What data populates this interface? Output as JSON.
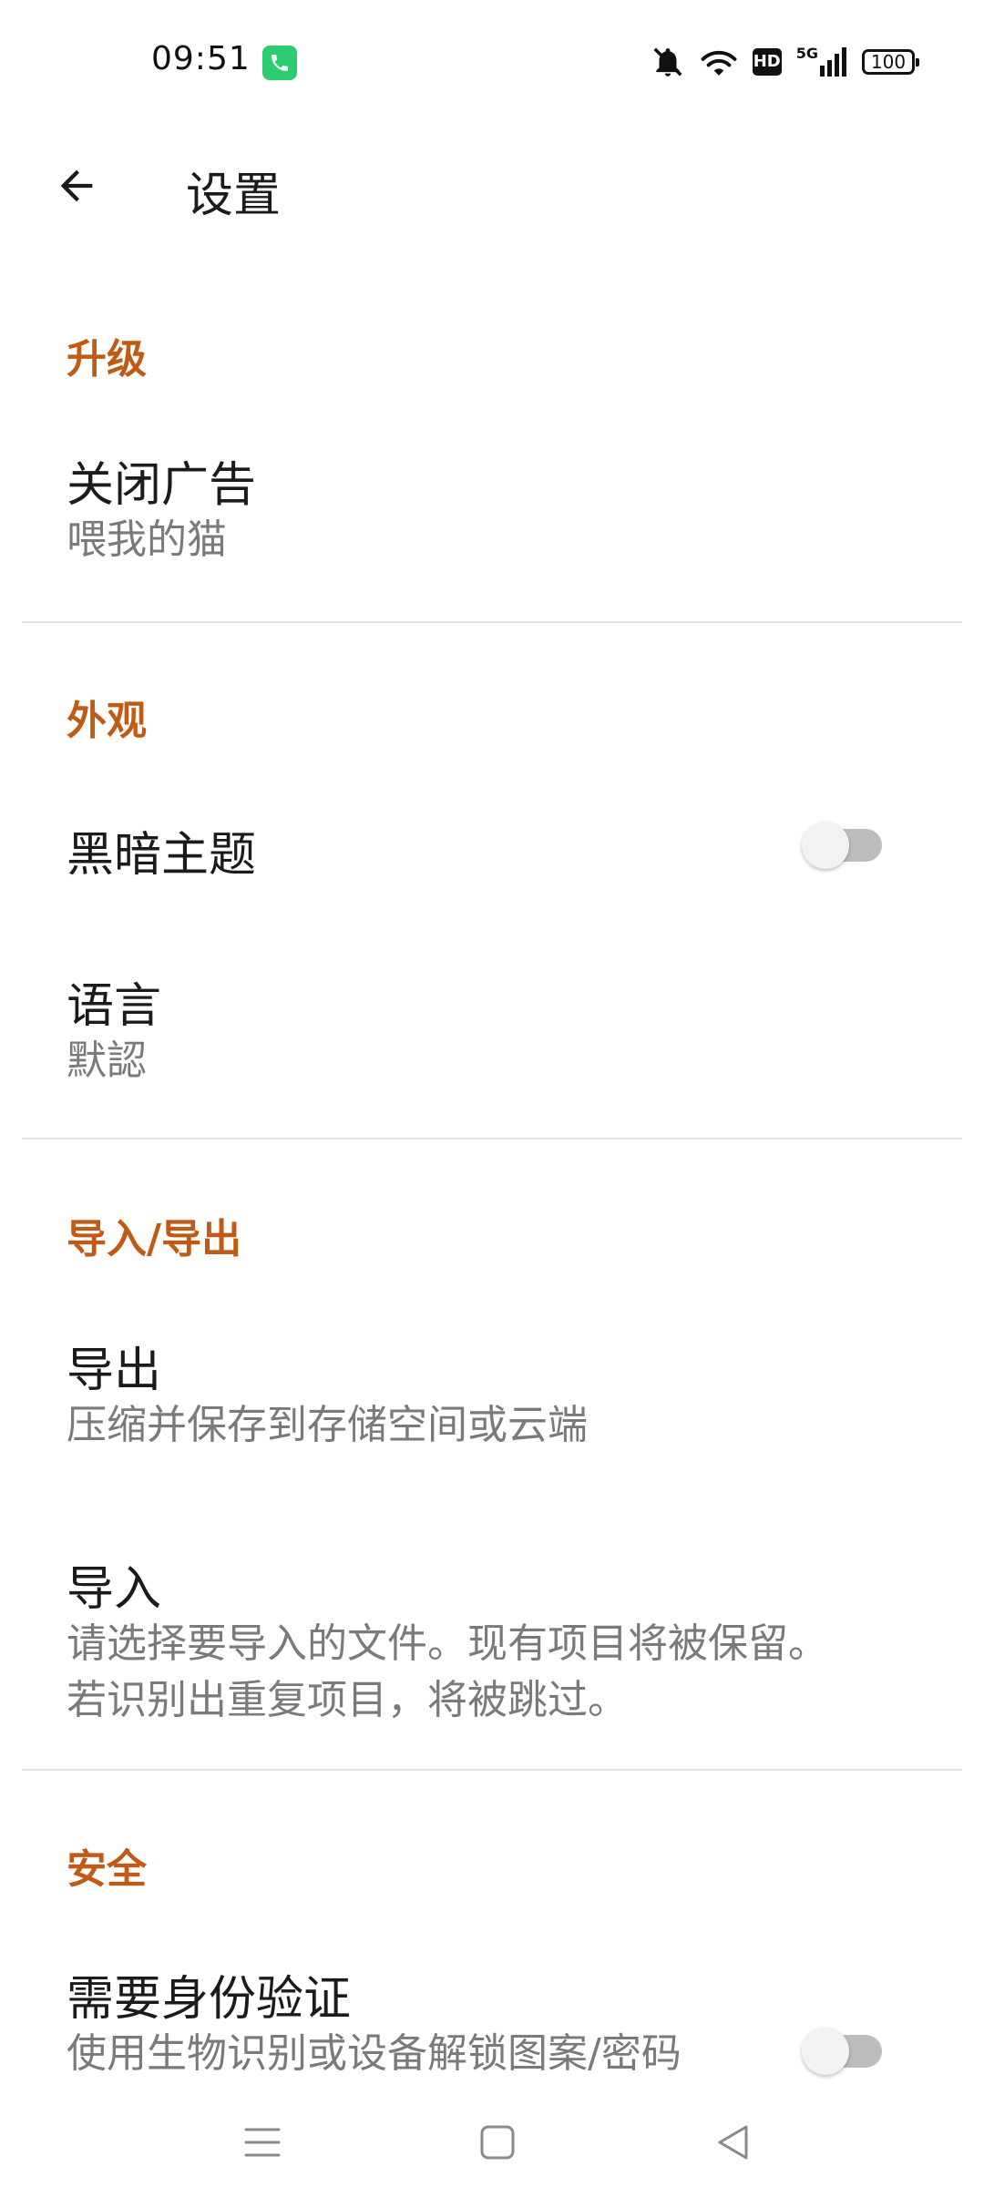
{
  "status_bar": {
    "time": "09:51",
    "network": "5G",
    "hd": "HD",
    "battery": "100"
  },
  "app_bar": {
    "title": "设置"
  },
  "sections": {
    "upgrade": {
      "header": "升级",
      "remove_ads_title": "关闭广告",
      "remove_ads_summary": "喂我的猫"
    },
    "appearance": {
      "header": "外观",
      "dark_theme_title": "黑暗主题",
      "dark_theme_enabled": false,
      "language_title": "语言",
      "language_value": "默認"
    },
    "import_export": {
      "header": "导入/导出",
      "export_title": "导出",
      "export_summary": "压缩并保存到存储空间或云端",
      "import_title": "导入",
      "import_summary_line1": "请选择要导入的文件。现有项目将被保留。",
      "import_summary_line2": "若识别出重复项目，将被跳过。"
    },
    "security": {
      "header": "安全",
      "auth_title": "需要身份验证",
      "auth_summary": "使用生物识别或设备解锁图案/密码",
      "auth_enabled": false
    }
  },
  "colors": {
    "section_header": "#c05a14",
    "switch_track_off": "#bdbdbd",
    "switch_thumb_off": "#f2f2f2",
    "call_badge": "#2ecc71"
  }
}
